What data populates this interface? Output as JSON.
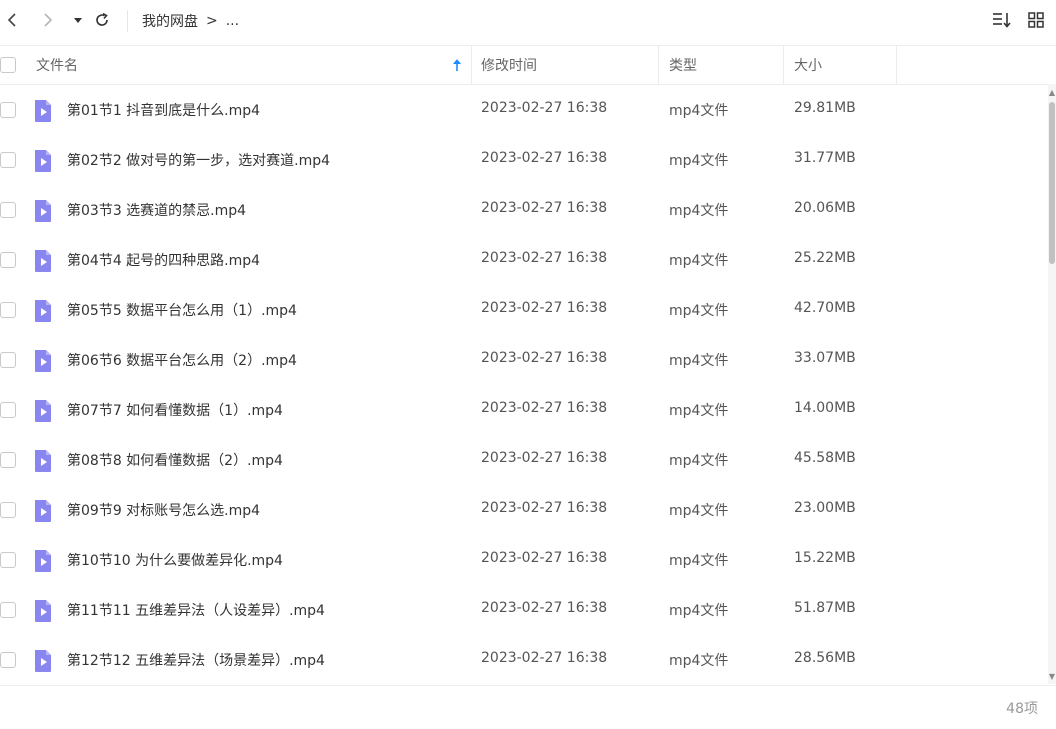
{
  "toolbar": {
    "back_icon": "chevron-left-icon",
    "forward_icon": "chevron-right-icon",
    "history_icon": "caret-down-icon",
    "refresh_icon": "refresh-icon",
    "breadcrumb": [
      "我的网盘",
      ">",
      "..."
    ],
    "sort_icon": "sort-list-icon",
    "grid_icon": "grid-view-icon"
  },
  "header": {
    "name": "文件名",
    "time": "修改时间",
    "type": "类型",
    "size": "大小",
    "sort_indicator": "↑"
  },
  "files": [
    {
      "name": "第01节1 抖音到底是什么.mp4",
      "time": "2023-02-27 16:38",
      "type": "mp4文件",
      "size": "29.81MB"
    },
    {
      "name": "第02节2 做对号的第一步，选对赛道.mp4",
      "time": "2023-02-27 16:38",
      "type": "mp4文件",
      "size": "31.77MB"
    },
    {
      "name": "第03节3 选赛道的禁忌.mp4",
      "time": "2023-02-27 16:38",
      "type": "mp4文件",
      "size": "20.06MB"
    },
    {
      "name": "第04节4 起号的四种思路.mp4",
      "time": "2023-02-27 16:38",
      "type": "mp4文件",
      "size": "25.22MB"
    },
    {
      "name": "第05节5 数据平台怎么用（1）.mp4",
      "time": "2023-02-27 16:38",
      "type": "mp4文件",
      "size": "42.70MB"
    },
    {
      "name": "第06节6 数据平台怎么用（2）.mp4",
      "time": "2023-02-27 16:38",
      "type": "mp4文件",
      "size": "33.07MB"
    },
    {
      "name": "第07节7 如何看懂数据（1）.mp4",
      "time": "2023-02-27 16:38",
      "type": "mp4文件",
      "size": "14.00MB"
    },
    {
      "name": "第08节8 如何看懂数据（2）.mp4",
      "time": "2023-02-27 16:38",
      "type": "mp4文件",
      "size": "45.58MB"
    },
    {
      "name": "第09节9 对标账号怎么选.mp4",
      "time": "2023-02-27 16:38",
      "type": "mp4文件",
      "size": "23.00MB"
    },
    {
      "name": "第10节10 为什么要做差异化.mp4",
      "time": "2023-02-27 16:38",
      "type": "mp4文件",
      "size": "15.22MB"
    },
    {
      "name": "第11节11 五维差异法（人设差异）.mp4",
      "time": "2023-02-27 16:38",
      "type": "mp4文件",
      "size": "51.87MB"
    },
    {
      "name": "第12节12 五维差异法（场景差异）.mp4",
      "time": "2023-02-27 16:38",
      "type": "mp4文件",
      "size": "28.56MB"
    }
  ],
  "footer": {
    "count": "48项"
  },
  "colors": {
    "file_icon": "#8a86f0",
    "sort_arrow": "#1a8cff"
  }
}
